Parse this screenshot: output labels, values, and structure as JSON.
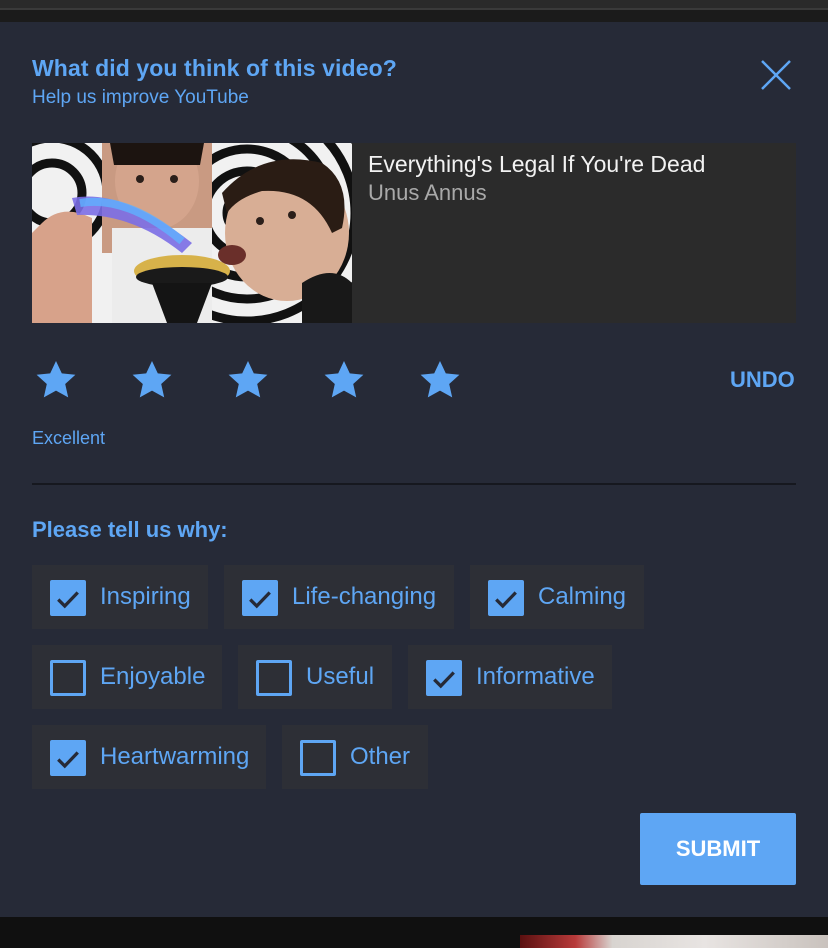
{
  "dialog": {
    "title": "What did you think of this video?",
    "subtitle": "Help us improve YouTube",
    "close_icon": "close-icon"
  },
  "video": {
    "title": "Everything's Legal If You're Dead",
    "channel": "Unus Annus"
  },
  "rating": {
    "stars_total": 5,
    "stars_selected": 5,
    "label": "Excellent",
    "undo_label": "UNDO"
  },
  "reasons": {
    "heading": "Please tell us why:",
    "options": [
      {
        "label": "Inspiring",
        "checked": true
      },
      {
        "label": "Life-changing",
        "checked": true
      },
      {
        "label": "Calming",
        "checked": true
      },
      {
        "label": "Enjoyable",
        "checked": false
      },
      {
        "label": "Useful",
        "checked": false
      },
      {
        "label": "Informative",
        "checked": true
      },
      {
        "label": "Heartwarming",
        "checked": true
      },
      {
        "label": "Other",
        "checked": false
      }
    ]
  },
  "submit_label": "SUBMIT",
  "colors": {
    "accent": "#5ea6f4",
    "dialog_bg": "#262a37",
    "chip_bg": "#2d2f36"
  }
}
